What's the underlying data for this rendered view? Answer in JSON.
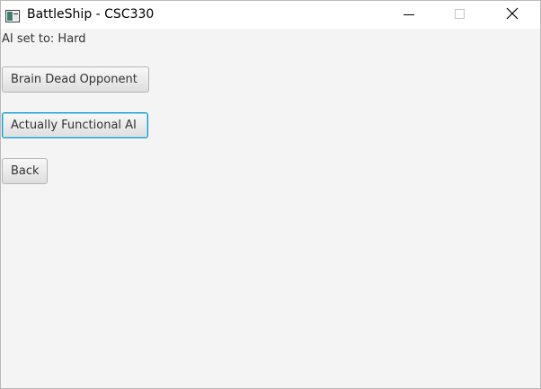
{
  "window": {
    "title": "BattleShip - CSC330",
    "icons": {
      "app": "app-window-icon",
      "minimize": "minimize-icon",
      "maximize": "maximize-icon",
      "close": "close-icon"
    }
  },
  "main": {
    "status_label": "AI set to: Hard",
    "buttons": {
      "brain_dead": "Brain Dead Opponent",
      "functional": "Actually Functional AI",
      "back": "Back"
    },
    "focus_color": "#0096c9"
  }
}
